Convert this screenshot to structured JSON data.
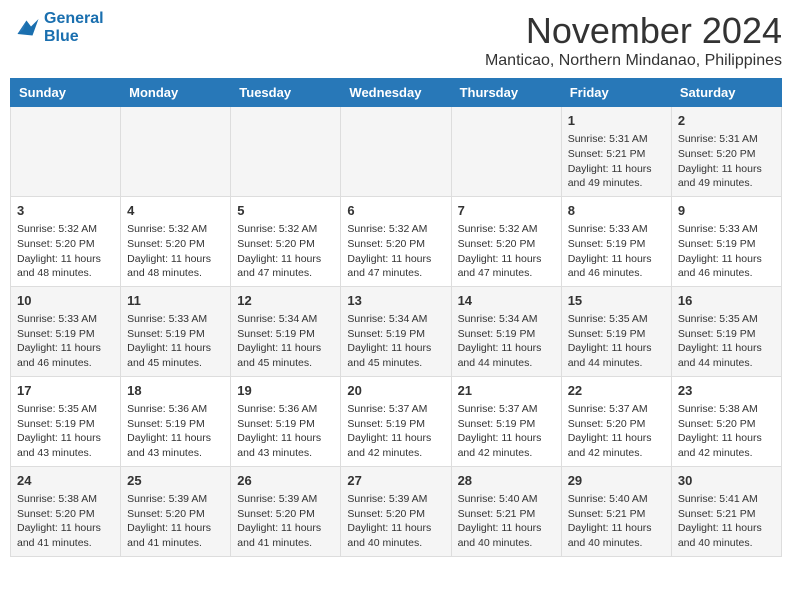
{
  "logo": {
    "line1": "General",
    "line2": "Blue"
  },
  "title": "November 2024",
  "location": "Manticao, Northern Mindanao, Philippines",
  "days_header": [
    "Sunday",
    "Monday",
    "Tuesday",
    "Wednesday",
    "Thursday",
    "Friday",
    "Saturday"
  ],
  "weeks": [
    [
      {
        "day": "",
        "info": ""
      },
      {
        "day": "",
        "info": ""
      },
      {
        "day": "",
        "info": ""
      },
      {
        "day": "",
        "info": ""
      },
      {
        "day": "",
        "info": ""
      },
      {
        "day": "1",
        "info": "Sunrise: 5:31 AM\nSunset: 5:21 PM\nDaylight: 11 hours and 49 minutes."
      },
      {
        "day": "2",
        "info": "Sunrise: 5:31 AM\nSunset: 5:20 PM\nDaylight: 11 hours and 49 minutes."
      }
    ],
    [
      {
        "day": "3",
        "info": "Sunrise: 5:32 AM\nSunset: 5:20 PM\nDaylight: 11 hours and 48 minutes."
      },
      {
        "day": "4",
        "info": "Sunrise: 5:32 AM\nSunset: 5:20 PM\nDaylight: 11 hours and 48 minutes."
      },
      {
        "day": "5",
        "info": "Sunrise: 5:32 AM\nSunset: 5:20 PM\nDaylight: 11 hours and 47 minutes."
      },
      {
        "day": "6",
        "info": "Sunrise: 5:32 AM\nSunset: 5:20 PM\nDaylight: 11 hours and 47 minutes."
      },
      {
        "day": "7",
        "info": "Sunrise: 5:32 AM\nSunset: 5:20 PM\nDaylight: 11 hours and 47 minutes."
      },
      {
        "day": "8",
        "info": "Sunrise: 5:33 AM\nSunset: 5:19 PM\nDaylight: 11 hours and 46 minutes."
      },
      {
        "day": "9",
        "info": "Sunrise: 5:33 AM\nSunset: 5:19 PM\nDaylight: 11 hours and 46 minutes."
      }
    ],
    [
      {
        "day": "10",
        "info": "Sunrise: 5:33 AM\nSunset: 5:19 PM\nDaylight: 11 hours and 46 minutes."
      },
      {
        "day": "11",
        "info": "Sunrise: 5:33 AM\nSunset: 5:19 PM\nDaylight: 11 hours and 45 minutes."
      },
      {
        "day": "12",
        "info": "Sunrise: 5:34 AM\nSunset: 5:19 PM\nDaylight: 11 hours and 45 minutes."
      },
      {
        "day": "13",
        "info": "Sunrise: 5:34 AM\nSunset: 5:19 PM\nDaylight: 11 hours and 45 minutes."
      },
      {
        "day": "14",
        "info": "Sunrise: 5:34 AM\nSunset: 5:19 PM\nDaylight: 11 hours and 44 minutes."
      },
      {
        "day": "15",
        "info": "Sunrise: 5:35 AM\nSunset: 5:19 PM\nDaylight: 11 hours and 44 minutes."
      },
      {
        "day": "16",
        "info": "Sunrise: 5:35 AM\nSunset: 5:19 PM\nDaylight: 11 hours and 44 minutes."
      }
    ],
    [
      {
        "day": "17",
        "info": "Sunrise: 5:35 AM\nSunset: 5:19 PM\nDaylight: 11 hours and 43 minutes."
      },
      {
        "day": "18",
        "info": "Sunrise: 5:36 AM\nSunset: 5:19 PM\nDaylight: 11 hours and 43 minutes."
      },
      {
        "day": "19",
        "info": "Sunrise: 5:36 AM\nSunset: 5:19 PM\nDaylight: 11 hours and 43 minutes."
      },
      {
        "day": "20",
        "info": "Sunrise: 5:37 AM\nSunset: 5:19 PM\nDaylight: 11 hours and 42 minutes."
      },
      {
        "day": "21",
        "info": "Sunrise: 5:37 AM\nSunset: 5:19 PM\nDaylight: 11 hours and 42 minutes."
      },
      {
        "day": "22",
        "info": "Sunrise: 5:37 AM\nSunset: 5:20 PM\nDaylight: 11 hours and 42 minutes."
      },
      {
        "day": "23",
        "info": "Sunrise: 5:38 AM\nSunset: 5:20 PM\nDaylight: 11 hours and 42 minutes."
      }
    ],
    [
      {
        "day": "24",
        "info": "Sunrise: 5:38 AM\nSunset: 5:20 PM\nDaylight: 11 hours and 41 minutes."
      },
      {
        "day": "25",
        "info": "Sunrise: 5:39 AM\nSunset: 5:20 PM\nDaylight: 11 hours and 41 minutes."
      },
      {
        "day": "26",
        "info": "Sunrise: 5:39 AM\nSunset: 5:20 PM\nDaylight: 11 hours and 41 minutes."
      },
      {
        "day": "27",
        "info": "Sunrise: 5:39 AM\nSunset: 5:20 PM\nDaylight: 11 hours and 40 minutes."
      },
      {
        "day": "28",
        "info": "Sunrise: 5:40 AM\nSunset: 5:21 PM\nDaylight: 11 hours and 40 minutes."
      },
      {
        "day": "29",
        "info": "Sunrise: 5:40 AM\nSunset: 5:21 PM\nDaylight: 11 hours and 40 minutes."
      },
      {
        "day": "30",
        "info": "Sunrise: 5:41 AM\nSunset: 5:21 PM\nDaylight: 11 hours and 40 minutes."
      }
    ]
  ]
}
